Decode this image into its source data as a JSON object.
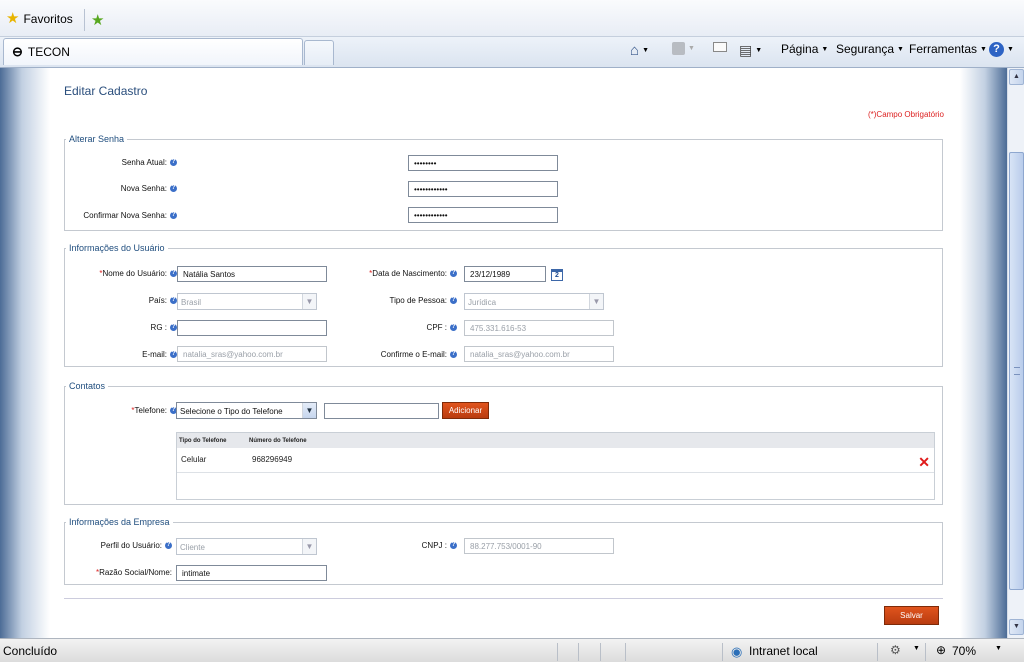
{
  "browser": {
    "favorites_label": "Favoritos",
    "tab_title": "TECON",
    "menu": {
      "page": "Página",
      "security": "Segurança",
      "tools": "Ferramentas"
    }
  },
  "page": {
    "title": "Editar Cadastro",
    "required_note": "(*)Campo Obrigatório"
  },
  "password_section": {
    "legend": "Alterar Senha",
    "current_label": "Senha Atual:",
    "current_value": "••••••••",
    "new_label": "Nova Senha:",
    "new_value": "••••••••••••",
    "confirm_label": "Confirmar Nova Senha:",
    "confirm_value": "••••••••••••"
  },
  "user_section": {
    "legend": "Informações do Usuário",
    "name_label": "Nome do Usuário:",
    "name_value": "Natália Santos",
    "birth_label": "Data de Nascimento:",
    "birth_value": "23/12/1989",
    "country_label": "País:",
    "country_value": "Brasil",
    "person_type_label": "Tipo de Pessoa:",
    "person_type_value": "Jurídica",
    "rg_label": "RG :",
    "rg_value": "",
    "cpf_label": "CPF :",
    "cpf_value": "475.331.616-53",
    "email_label": "E-mail:",
    "email_value": "natalia_sras@yahoo.com.br",
    "confirm_email_label": "Confirme o E-mail:",
    "confirm_email_value": "natalia_sras@yahoo.com.br"
  },
  "contacts_section": {
    "legend": "Contatos",
    "phone_label": "Telefone:",
    "phone_type_select": "Selecione o Tipo do Telefone",
    "phone_number_value": "",
    "add_button": "Adicionar",
    "grid_headers": [
      "Tipo do Telefone",
      "Número do Telefone"
    ],
    "rows": [
      {
        "type": "Celular",
        "number": "968296949"
      }
    ]
  },
  "company_section": {
    "legend": "Informações da Empresa",
    "profile_label": "Perfil do Usuário:",
    "profile_value": "Cliente",
    "cnpj_label": "CNPJ :",
    "cnpj_value": "88.277.753/0001-90",
    "company_name_label": "Razão Social/Nome:",
    "company_name_value": "intimate"
  },
  "save_button": "Salvar",
  "status": {
    "left": "Concluído",
    "zone": "Intranet local",
    "zoom": "70%"
  },
  "colors": {
    "accent_button": "#c94516",
    "link_blue": "#2a4e7c",
    "required_red": "#dd2222"
  }
}
